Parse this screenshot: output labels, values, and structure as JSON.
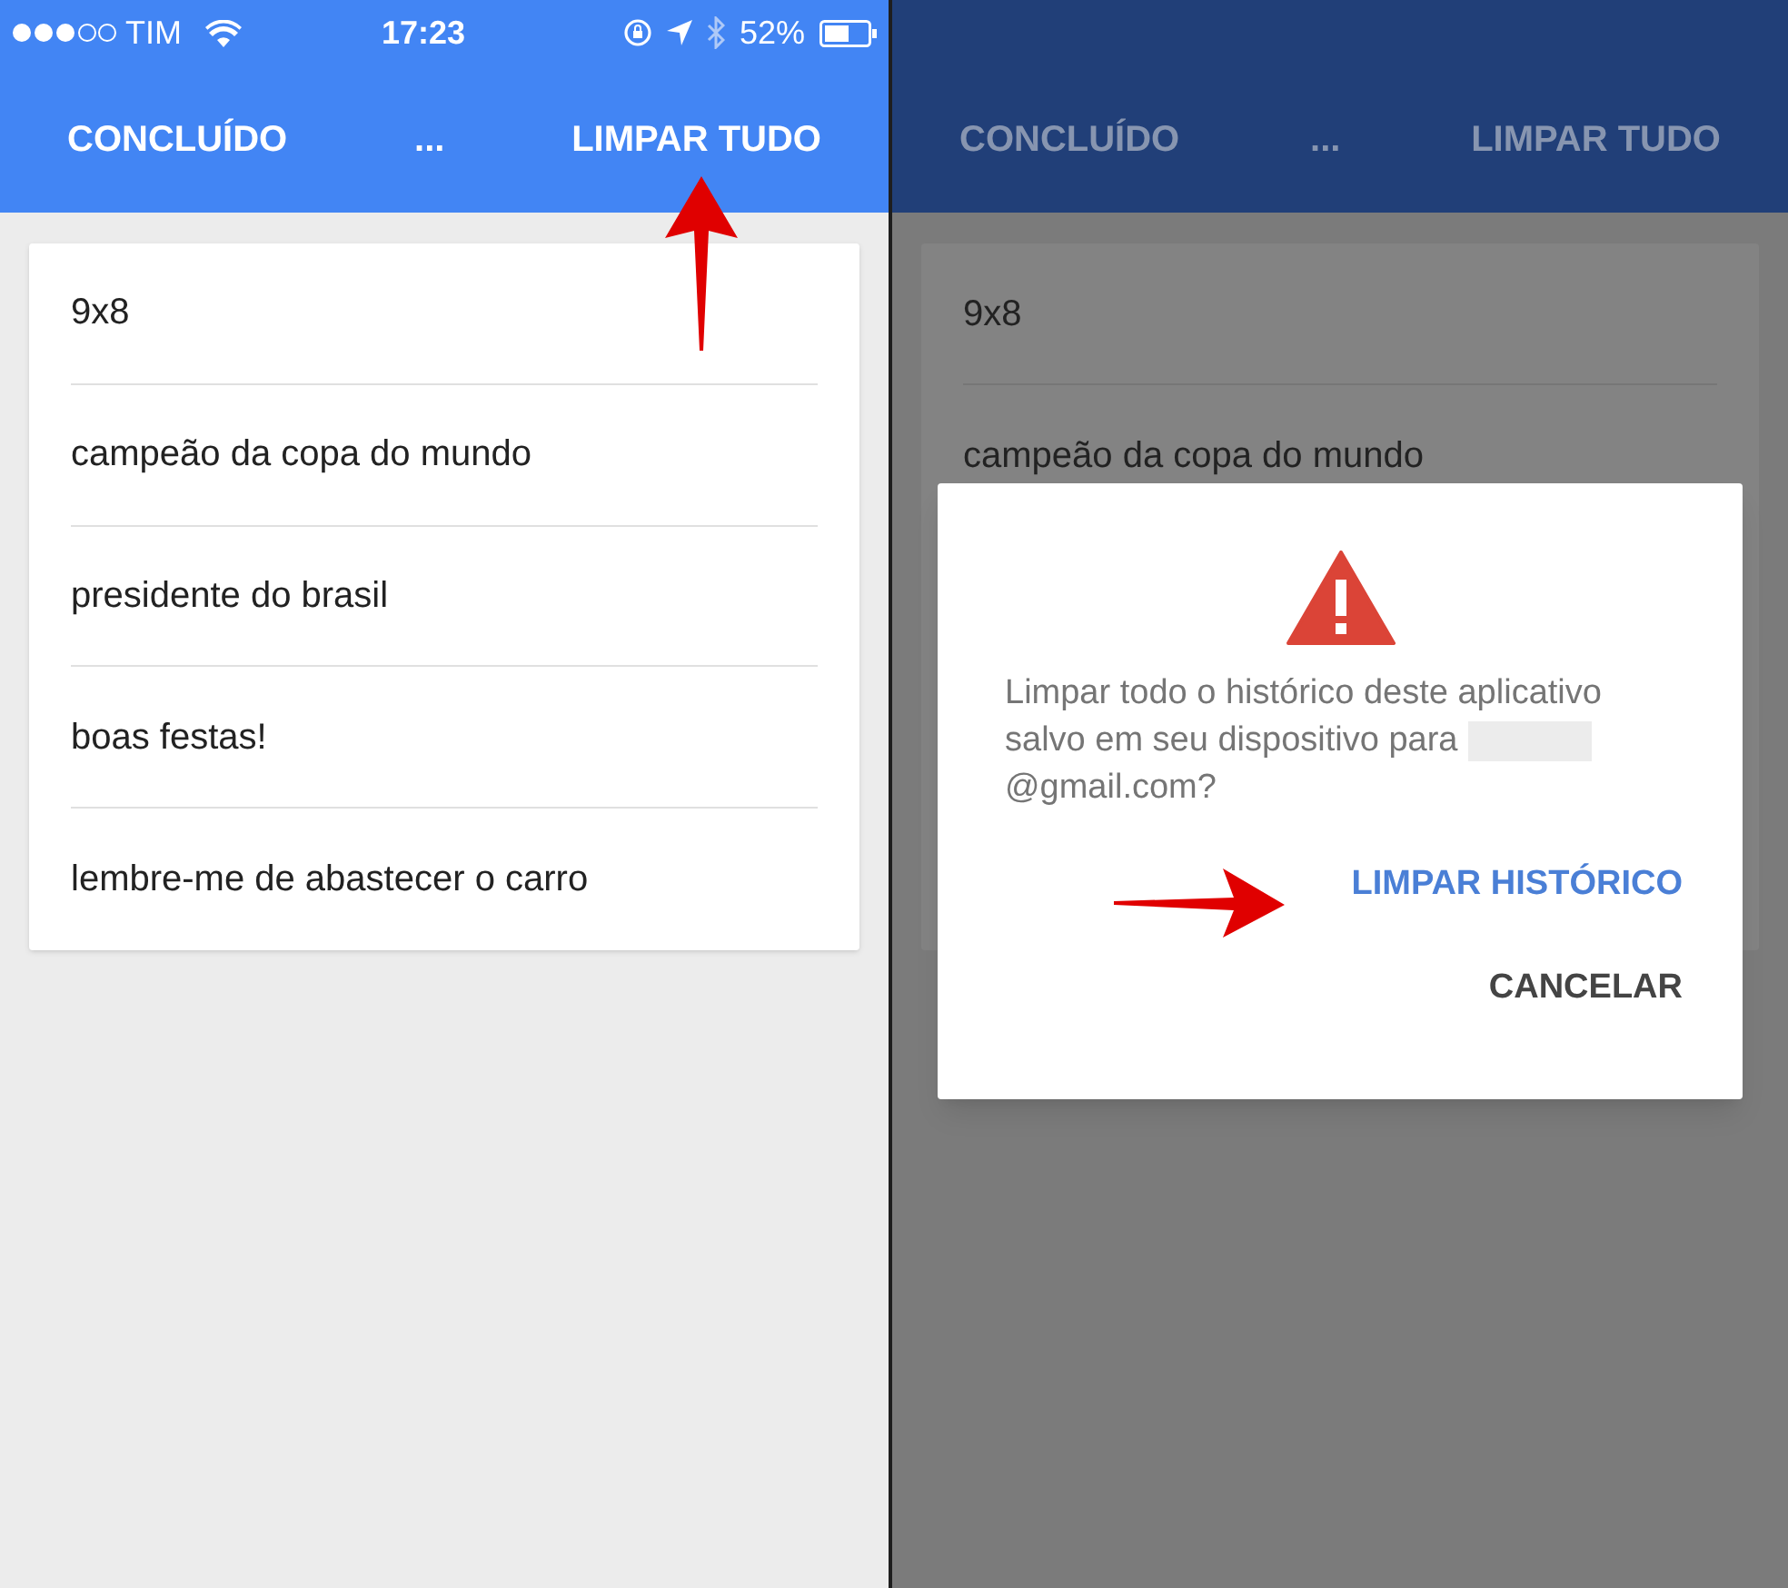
{
  "left_screen": {
    "status_bar": {
      "carrier": "TIM",
      "time": "17:23",
      "battery_percent": "52%"
    },
    "toolbar": {
      "done": "CONCLUÍDO",
      "more": "...",
      "clear_all": "LIMPAR TUDO"
    },
    "history": [
      "9x8",
      "campeão da copa do mundo",
      "presidente do brasil",
      "boas festas!",
      "lembre-me de abastecer o carro"
    ]
  },
  "right_screen": {
    "toolbar": {
      "done": "CONCLUÍDO",
      "more": "...",
      "clear_all": "LIMPAR TUDO"
    },
    "history": [
      "9x8",
      "campeão da copa do mundo"
    ],
    "dialog": {
      "message_start": "Limpar todo o histórico deste aplicativo salvo em seu dispositivo para",
      "message_end": "@gmail.com?",
      "buttons": [
        {
          "label": "LIMPAR HISTÓRICO",
          "kind": "primary"
        },
        {
          "label": "CANCELAR",
          "kind": "secondary"
        }
      ]
    }
  }
}
